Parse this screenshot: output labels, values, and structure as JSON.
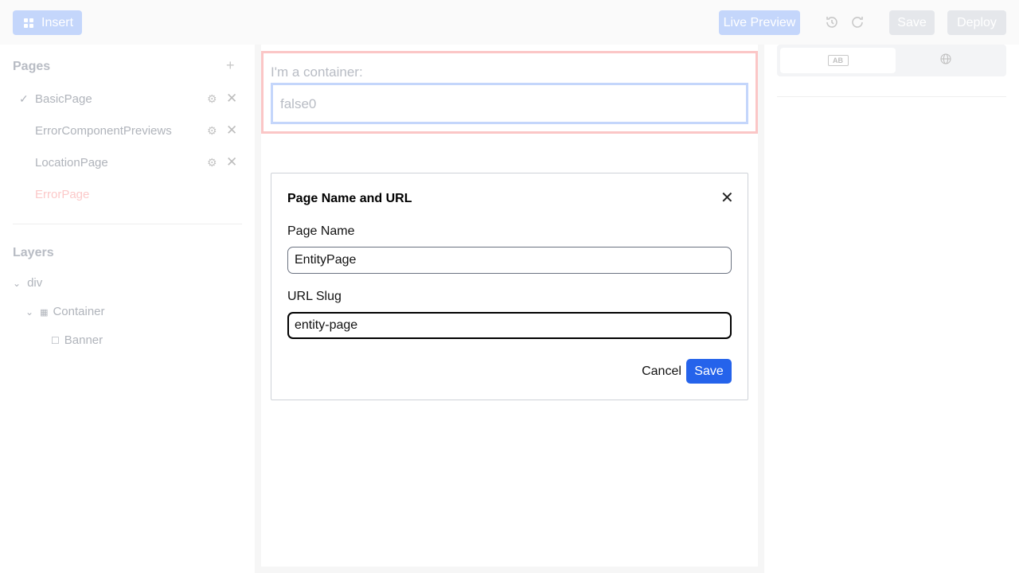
{
  "toolbar": {
    "insert_label": "Insert",
    "live_preview_label": "Live Preview",
    "save_label": "Save",
    "deploy_label": "Deploy"
  },
  "sidebar": {
    "pages_title": "Pages",
    "add_icon": "+",
    "pages": [
      {
        "label": "BasicPage",
        "selected": true
      },
      {
        "label": "ErrorComponentPreviews",
        "selected": false
      },
      {
        "label": "LocationPage",
        "selected": false
      },
      {
        "label": "ErrorPage",
        "selected": false,
        "error": true
      }
    ],
    "layers_title": "Layers",
    "layers": [
      {
        "label": "div"
      },
      {
        "label": "Container"
      },
      {
        "label": "Banner"
      }
    ]
  },
  "canvas": {
    "container_text": "I'm a container:",
    "banner_text": "false0"
  },
  "modal": {
    "title": "Page Name and URL",
    "page_name_label": "Page Name",
    "page_name_value": "EntityPage",
    "url_slug_label": "URL Slug",
    "url_slug_value": "entity-page",
    "cancel_label": "Cancel",
    "save_label": "Save"
  },
  "right_panel": {
    "tab_ab_label": "AB"
  },
  "colors": {
    "primary": "#2563eb",
    "primary_disabled": "#c4d6fb",
    "error_outline": "#fbc6c6"
  }
}
